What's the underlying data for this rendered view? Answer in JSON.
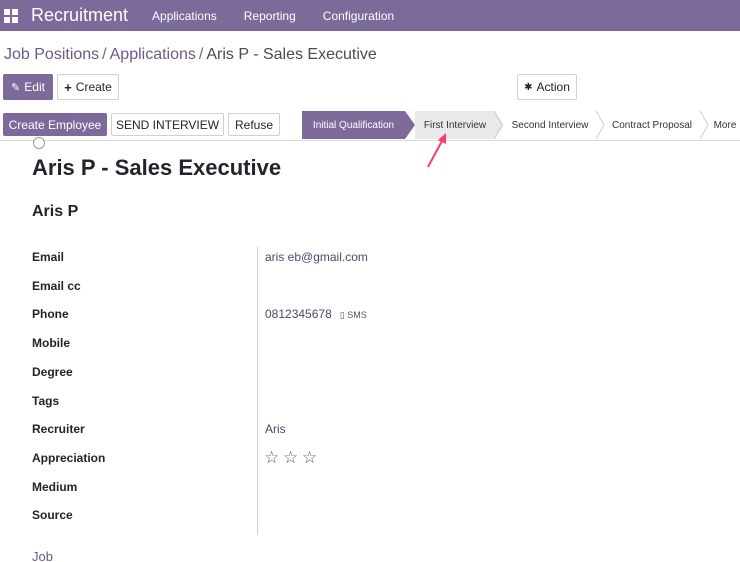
{
  "topbar": {
    "app_title": "Recruitment",
    "menu": [
      "Applications",
      "Reporting",
      "Configuration"
    ]
  },
  "breadcrumb": {
    "items": [
      "Job Positions",
      "Applications"
    ],
    "current": "Aris P - Sales Executive"
  },
  "toolbar": {
    "edit_label": "Edit",
    "create_label": "Create",
    "action_label": "Action"
  },
  "statusbar": {
    "buttons": [
      "Create Employee",
      "SEND INTERVIEW",
      "Refuse"
    ],
    "stages": [
      "Initial Qualification",
      "First Interview",
      "Second Interview",
      "Contract Proposal",
      "More"
    ],
    "active_stage": "Initial Qualification"
  },
  "form": {
    "title": "Aris P - Sales Executive",
    "partner_name": "Aris P",
    "fields": [
      {
        "label": "Email",
        "value": "aris        eb@gmail.com"
      },
      {
        "label": "Email cc",
        "value": ""
      },
      {
        "label": "Phone",
        "value": "0812345678"
      },
      {
        "label": "Mobile",
        "value": ""
      },
      {
        "label": "Degree",
        "value": ""
      },
      {
        "label": "Tags",
        "value": ""
      },
      {
        "label": "Recruiter",
        "value": "Aris"
      },
      {
        "label": "Appreciation",
        "value": ""
      },
      {
        "label": "Medium",
        "value": ""
      },
      {
        "label": "Source",
        "value": ""
      }
    ],
    "sms_label": "SMS",
    "appreciation_stars": 0,
    "appreciation_max": 3,
    "section_label": "Job"
  },
  "colors": {
    "brand": "#7c6a9a",
    "link": "#6d5a8b",
    "annotation": "#ff3b6b"
  }
}
